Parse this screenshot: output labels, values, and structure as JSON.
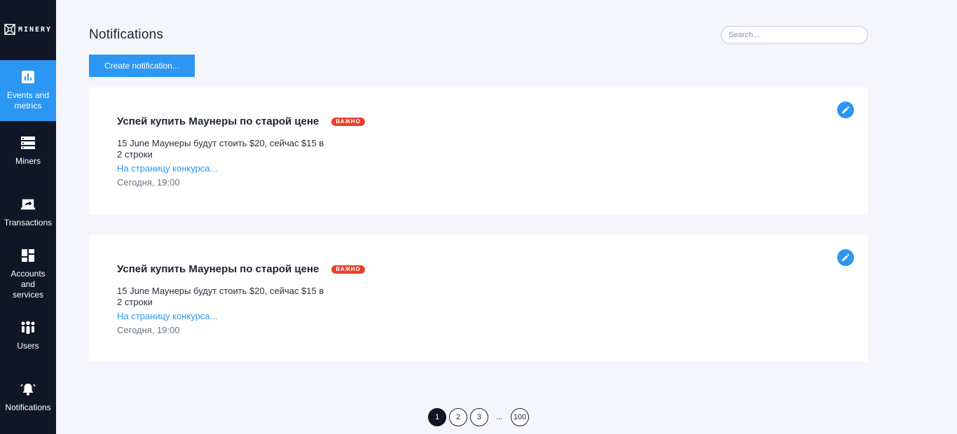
{
  "app": {
    "logo_text": "MINERY"
  },
  "sidebar": {
    "items": [
      {
        "label": "Events and metrics",
        "icon": "bar-chart-icon",
        "active": true
      },
      {
        "label": "Miners",
        "icon": "server-icon",
        "active": false
      },
      {
        "label": "Transactions",
        "icon": "laptop-share-icon",
        "active": false
      },
      {
        "label": "Accounts and services",
        "icon": "dashboard-icon",
        "active": false
      },
      {
        "label": "Users",
        "icon": "users-icon",
        "active": false
      },
      {
        "label": "Notifications",
        "icon": "bell-icon",
        "active": false
      }
    ]
  },
  "header": {
    "title": "Notifications",
    "search_placeholder": "Search...",
    "create_label": "Create notification..."
  },
  "notifications": [
    {
      "title": "Успей купить Маунеры по старой цене",
      "badge": "ВАЖНО",
      "body": "15 June Маунеры будут стоить $20, сейчас $15 в 2 строки",
      "link": "На страницу конкурса...",
      "time": "Сегодня, 19:00"
    },
    {
      "title": "Успей купить Маунеры по старой цене",
      "badge": "ВАЖНО",
      "body": "15 June Маунеры будут стоить $20, сейчас $15 в 2 строки",
      "link": "На страницу конкурса...",
      "time": "Сегодня, 19:00"
    }
  ],
  "pagination": {
    "pages": [
      "1",
      "2",
      "3"
    ],
    "ellipsis": "...",
    "last": "100",
    "current": "1"
  },
  "colors": {
    "accent": "#2b97f3",
    "sidebar": "#111627",
    "badge": "#e7402f",
    "background": "#f4f6fb"
  }
}
